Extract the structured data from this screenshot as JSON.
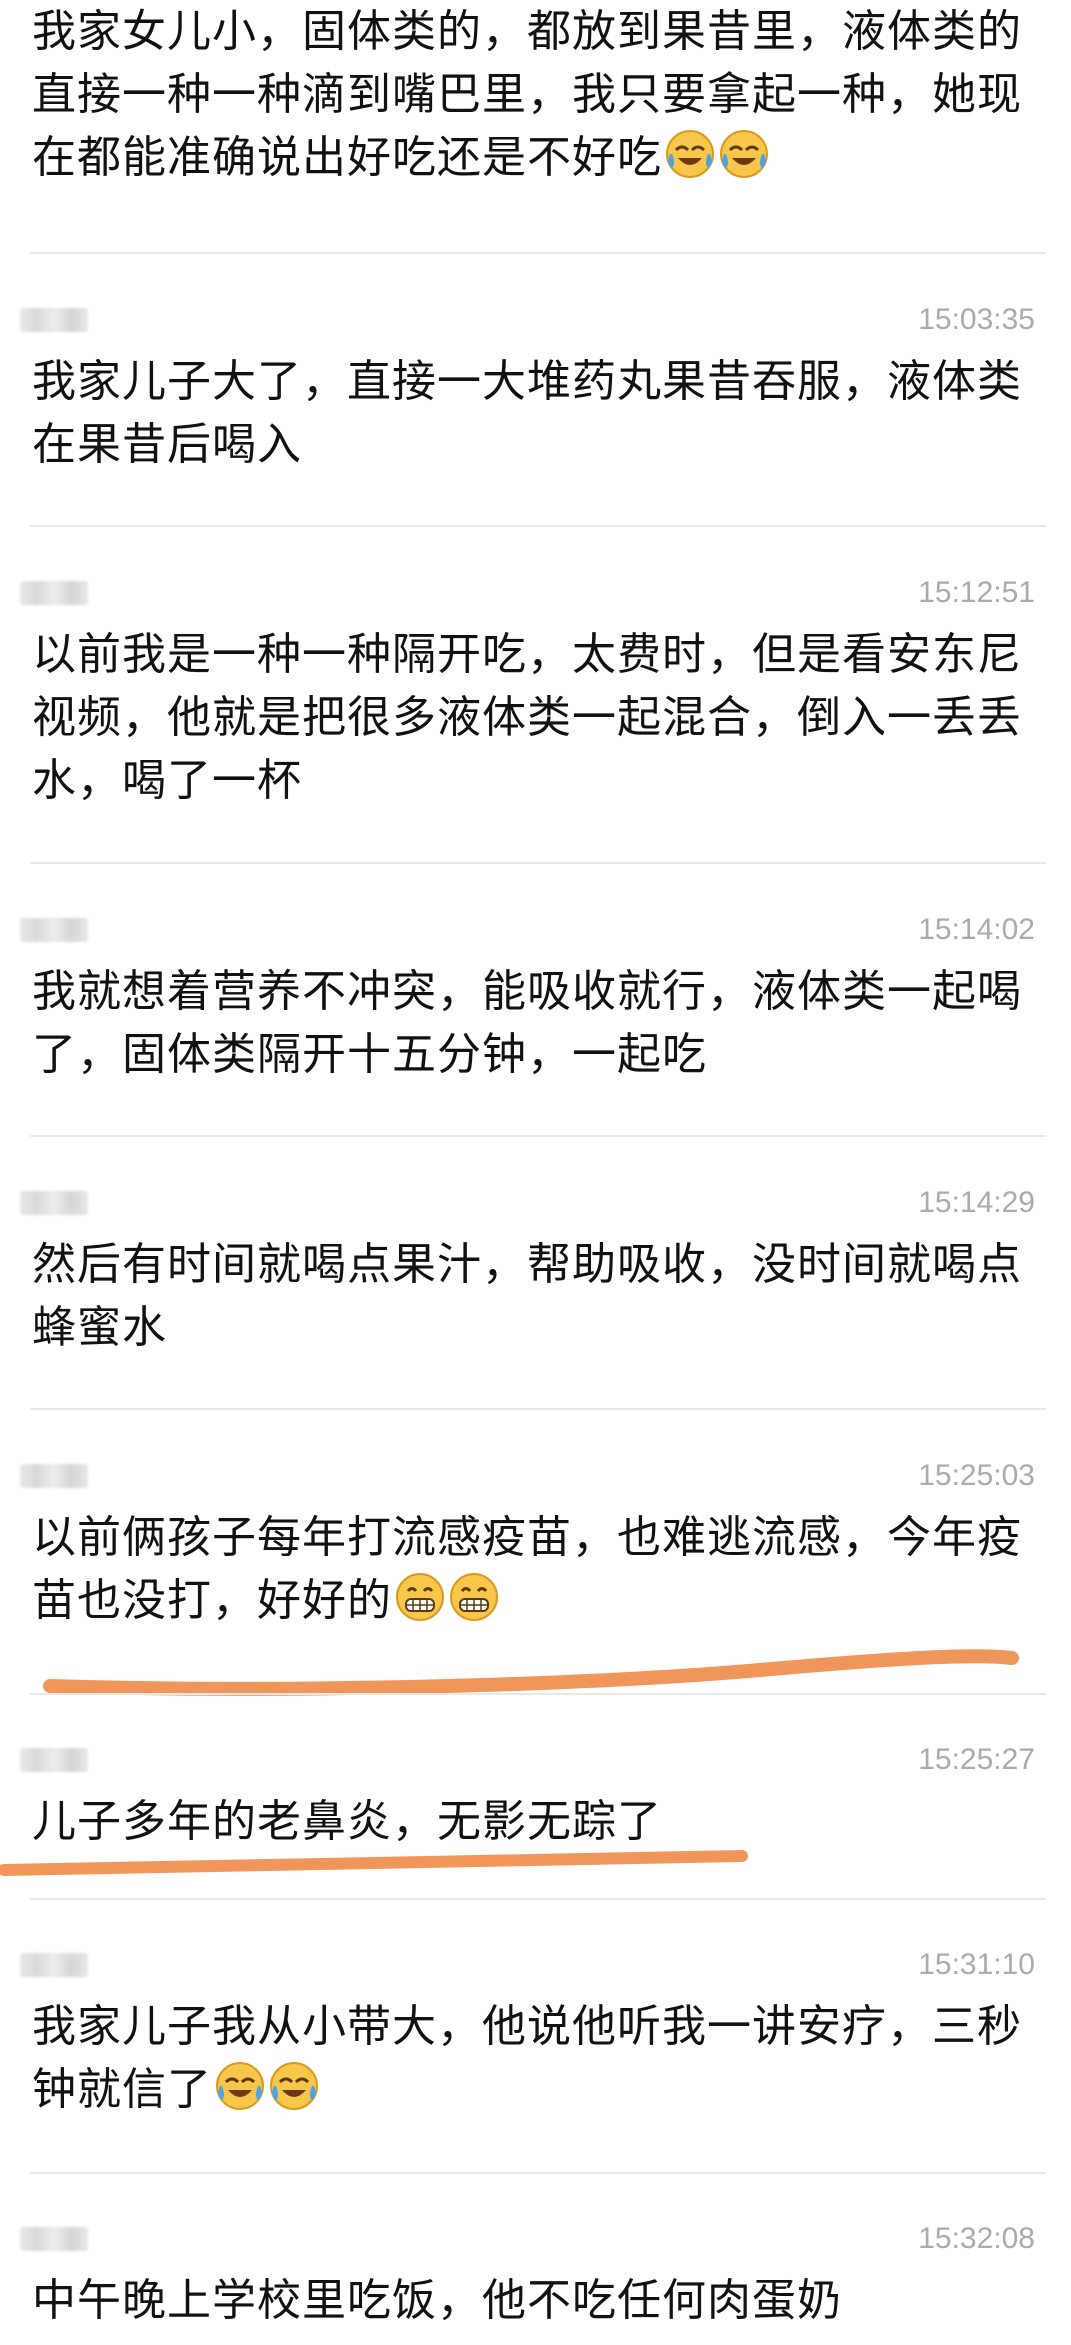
{
  "messages": [
    {
      "author_hidden": true,
      "timestamp": "",
      "text": "我家女儿小，固体类的，都放到果昔里，液体类的直接一种一种滴到嘴巴里，我只要拿起一种，她现在都能准确说出好吃还是不好吃",
      "emoji": [
        "crying-laugh-emoji",
        "crying-laugh-emoji"
      ]
    },
    {
      "author_hidden": true,
      "timestamp": "15:03:35",
      "text": "我家儿子大了，直接一大堆药丸果昔吞服，液体类在果昔后喝入",
      "emoji": []
    },
    {
      "author_hidden": true,
      "timestamp": "15:12:51",
      "text": "以前我是一种一种隔开吃，太费时，但是看安东尼视频，他就是把很多液体类一起混合，倒入一丢丢水，喝了一杯",
      "emoji": []
    },
    {
      "author_hidden": true,
      "timestamp": "15:14:02",
      "text": "我就想着营养不冲突，能吸收就行，液体类一起喝了，固体类隔开十五分钟，一起吃",
      "emoji": []
    },
    {
      "author_hidden": true,
      "timestamp": "15:14:29",
      "text": "然后有时间就喝点果汁，帮助吸收，没时间就喝点蜂蜜水",
      "emoji": []
    },
    {
      "author_hidden": true,
      "timestamp": "15:25:03",
      "text": "以前俩孩子每年打流感疫苗，也难逃流感，今年疫苗也没打，好好的",
      "emoji": [
        "grinning-emoji",
        "grinning-emoji"
      ]
    },
    {
      "author_hidden": true,
      "timestamp": "15:25:27",
      "text": "儿子多年的老鼻炎，无影无踪了",
      "emoji": []
    },
    {
      "author_hidden": true,
      "timestamp": "15:31:10",
      "text": "我家儿子我从小带大，他说他听我一讲安疗，三秒钟就信了",
      "emoji": [
        "crying-laugh-emoji",
        "crying-laugh-emoji"
      ]
    },
    {
      "author_hidden": true,
      "timestamp": "15:32:08",
      "text": "中午晚上学校里吃饭，他不吃任何肉蛋奶",
      "emoji": []
    }
  ],
  "colors": {
    "text": "#111111",
    "timestamp": "#aaaaaa",
    "divider": "#e8e8e8",
    "highlight_underline": "#f0965a",
    "emoji_face": "#f7c64a"
  }
}
